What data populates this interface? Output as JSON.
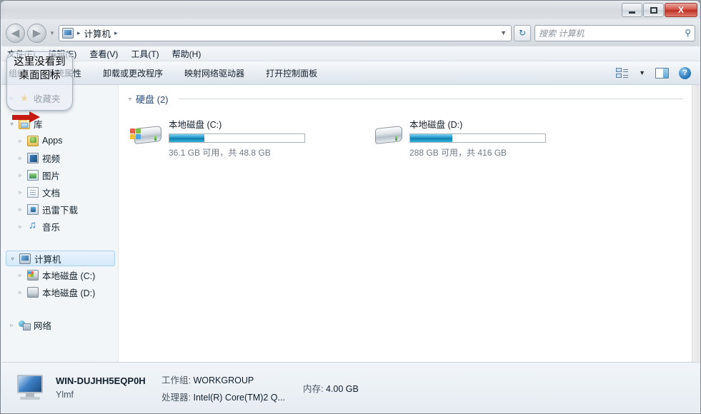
{
  "window": {
    "titlebar_buttons": {
      "minimize": "–",
      "maximize": "□",
      "close": "X"
    }
  },
  "nav": {
    "back_icon": "◀",
    "forward_icon": "▶",
    "history_caret": "▼",
    "breadcrumb_icon": "computer-icon",
    "breadcrumb": [
      "计算机"
    ],
    "separator": "▸",
    "address_dropdown": "▼",
    "refresh_icon": "↻",
    "search_placeholder": "搜索 计算机",
    "search_icon": "⚲"
  },
  "menubar": {
    "items": [
      {
        "label": "文件(F)"
      },
      {
        "label": "编辑(E)"
      },
      {
        "label": "查看(V)"
      },
      {
        "label": "工具(T)"
      },
      {
        "label": "帮助(H)"
      }
    ]
  },
  "toolbar": {
    "items": [
      {
        "label": "组织"
      },
      {
        "label": "系统属性"
      },
      {
        "label": "卸载或更改程序"
      },
      {
        "label": "映射网络驱动器"
      },
      {
        "label": "打开控制面板"
      }
    ],
    "view_caret": "▼",
    "help_label": "?"
  },
  "sidebar": {
    "items": [
      {
        "label": "收藏夹",
        "icon": "star-icon",
        "expander": "▹",
        "level": 0,
        "selected": false
      },
      {
        "label": "库",
        "icon": "library-folder-icon",
        "expander": "▿",
        "level": 0,
        "selected": false
      },
      {
        "label": "Apps",
        "icon": "apps-folder-icon",
        "expander": "▹",
        "level": 1,
        "selected": false
      },
      {
        "label": "视频",
        "icon": "video-library-icon",
        "expander": "▹",
        "level": 1,
        "selected": false
      },
      {
        "label": "图片",
        "icon": "pictures-library-icon",
        "expander": "▹",
        "level": 1,
        "selected": false
      },
      {
        "label": "文档",
        "icon": "documents-library-icon",
        "expander": "▹",
        "level": 1,
        "selected": false
      },
      {
        "label": "迅雷下载",
        "icon": "downloads-library-icon",
        "expander": "▹",
        "level": 1,
        "selected": false
      },
      {
        "label": "音乐",
        "icon": "music-library-icon",
        "expander": "▹",
        "level": 1,
        "selected": false
      },
      {
        "label": "计算机",
        "icon": "computer-icon",
        "expander": "▿",
        "level": 0,
        "selected": true
      },
      {
        "label": "本地磁盘 (C:)",
        "icon": "system-drive-icon",
        "expander": "▹",
        "level": 1,
        "selected": false
      },
      {
        "label": "本地磁盘 (D:)",
        "icon": "drive-icon",
        "expander": "▹",
        "level": 1,
        "selected": false
      },
      {
        "label": "网络",
        "icon": "network-icon",
        "expander": "▹",
        "level": 0,
        "selected": false
      }
    ]
  },
  "main": {
    "group": {
      "label": "硬盘 (2)",
      "triangle": "▿"
    },
    "drives": [
      {
        "name": "本地磁盘 (C:)",
        "capacity_text": "36.1 GB 可用，共 48.8 GB",
        "free_gb": 36.1,
        "total_gb": 48.8,
        "used_percent": 26,
        "bar_color": "#2196c8",
        "icon": "system-drive-icon"
      },
      {
        "name": "本地磁盘 (D:)",
        "capacity_text": "288 GB 可用，共 416 GB",
        "free_gb": 288,
        "total_gb": 416,
        "used_percent": 31,
        "bar_color": "#2196c8",
        "icon": "drive-icon"
      }
    ]
  },
  "statusbar": {
    "computer_name": "WIN-DUJHH5EQP0H",
    "os_name": "Ylmf",
    "workgroup_key": "工作组:",
    "workgroup_value": "WORKGROUP",
    "processor_key": "处理器:",
    "processor_value": "Intel(R) Core(TM)2 Q...",
    "memory_key": "内存:",
    "memory_value": "4.00 GB"
  },
  "annotation": {
    "callout_text": "这里没看到桌面图标",
    "arrow_color": "#c61a12"
  }
}
